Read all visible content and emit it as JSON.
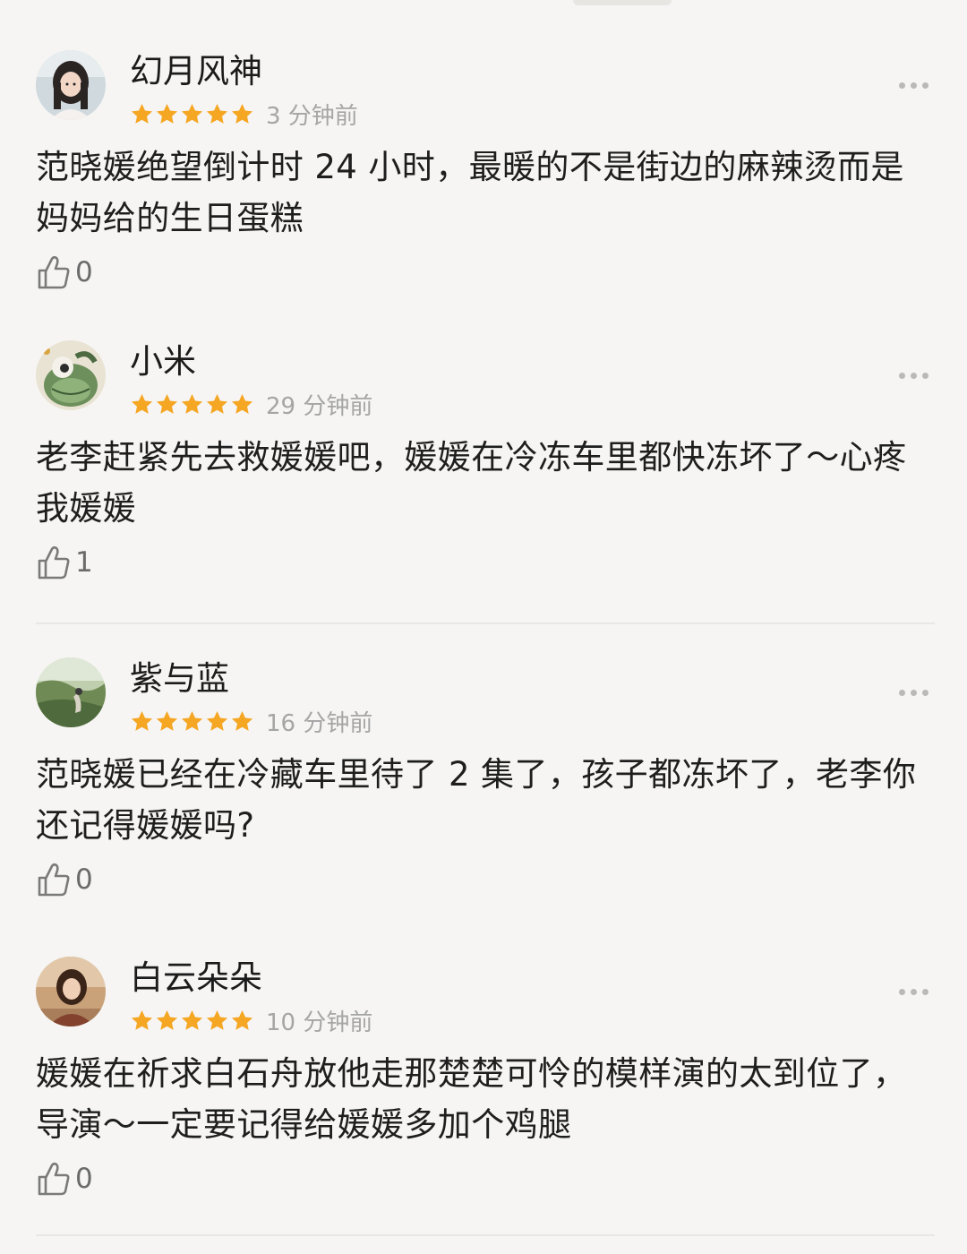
{
  "colors": {
    "background": "#f6f5f3",
    "star": "#f5a623",
    "time_text": "#a5a5a5",
    "divider": "#e8e7e4"
  },
  "comments": [
    {
      "username": "幻月风神",
      "rating": 5,
      "time": "3 分钟前",
      "text": "范晓媛绝望倒计时 24 小时，最暖的不是街边的麻辣烫而是妈妈给的生日蛋糕",
      "likes": "0",
      "avatar": "girl-avatar-icon"
    },
    {
      "username": "小米",
      "rating": 5,
      "time": "29 分钟前",
      "text": "老李赶紧先去救媛媛吧，媛媛在冷冻车里都快冻坏了～心疼我媛媛",
      "likes": "1",
      "avatar": "cartoon-monster-avatar-icon"
    },
    {
      "username": "紫与蓝",
      "rating": 5,
      "time": "16 分钟前",
      "text": "范晓媛已经在冷藏车里待了 2 集了，孩子都冻坏了，老李你还记得媛媛吗?",
      "likes": "0",
      "avatar": "landscape-avatar-icon"
    },
    {
      "username": "白云朵朵",
      "rating": 5,
      "time": "10 分钟前",
      "text": "媛媛在祈求白石舟放他走那楚楚可怜的模样演的太到位了，导演～一定要记得给媛媛多加个鸡腿",
      "likes": "0",
      "avatar": "woman-avatar-icon"
    }
  ]
}
